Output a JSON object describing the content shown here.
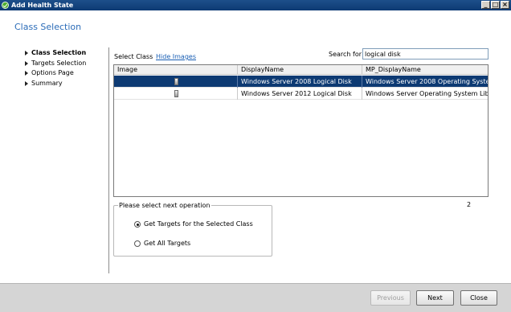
{
  "window": {
    "title": "Add Health State",
    "controls": [
      "minimize",
      "maximize",
      "close"
    ]
  },
  "page": {
    "title": "Class Selection"
  },
  "nav": {
    "items": [
      {
        "label": "Class Selection",
        "active": true
      },
      {
        "label": "Targets Selection",
        "active": false
      },
      {
        "label": "Options Page",
        "active": false
      },
      {
        "label": "Summary",
        "active": false
      }
    ]
  },
  "class_select": {
    "label": "Select Class",
    "hide_images_link": "Hide Images",
    "search_label": "Search for",
    "search_value": "logical disk"
  },
  "grid": {
    "columns": [
      "Image",
      "DisplayName",
      "MP_DisplayName"
    ],
    "rows": [
      {
        "image": "disk-icon",
        "display_name": "Windows Server 2008 Logical Disk",
        "mp_display_name": "Windows Server 2008 Operating Syste...",
        "selected": true
      },
      {
        "image": "disk-icon",
        "display_name": "Windows Server 2012 Logical Disk",
        "mp_display_name": "Windows Server Operating System Lib...",
        "selected": false
      }
    ],
    "count": "2"
  },
  "operation": {
    "group_label": "Please select next operation",
    "options": [
      {
        "label": "Get Targets for the Selected Class",
        "selected": true
      },
      {
        "label": "Get All Targets",
        "selected": false
      }
    ]
  },
  "footer": {
    "previous": "Previous",
    "next": "Next",
    "close": "Close"
  },
  "colors": {
    "title_accent": "#2b6cb8",
    "selection": "#0d3a73",
    "link": "#1a5fb4"
  }
}
